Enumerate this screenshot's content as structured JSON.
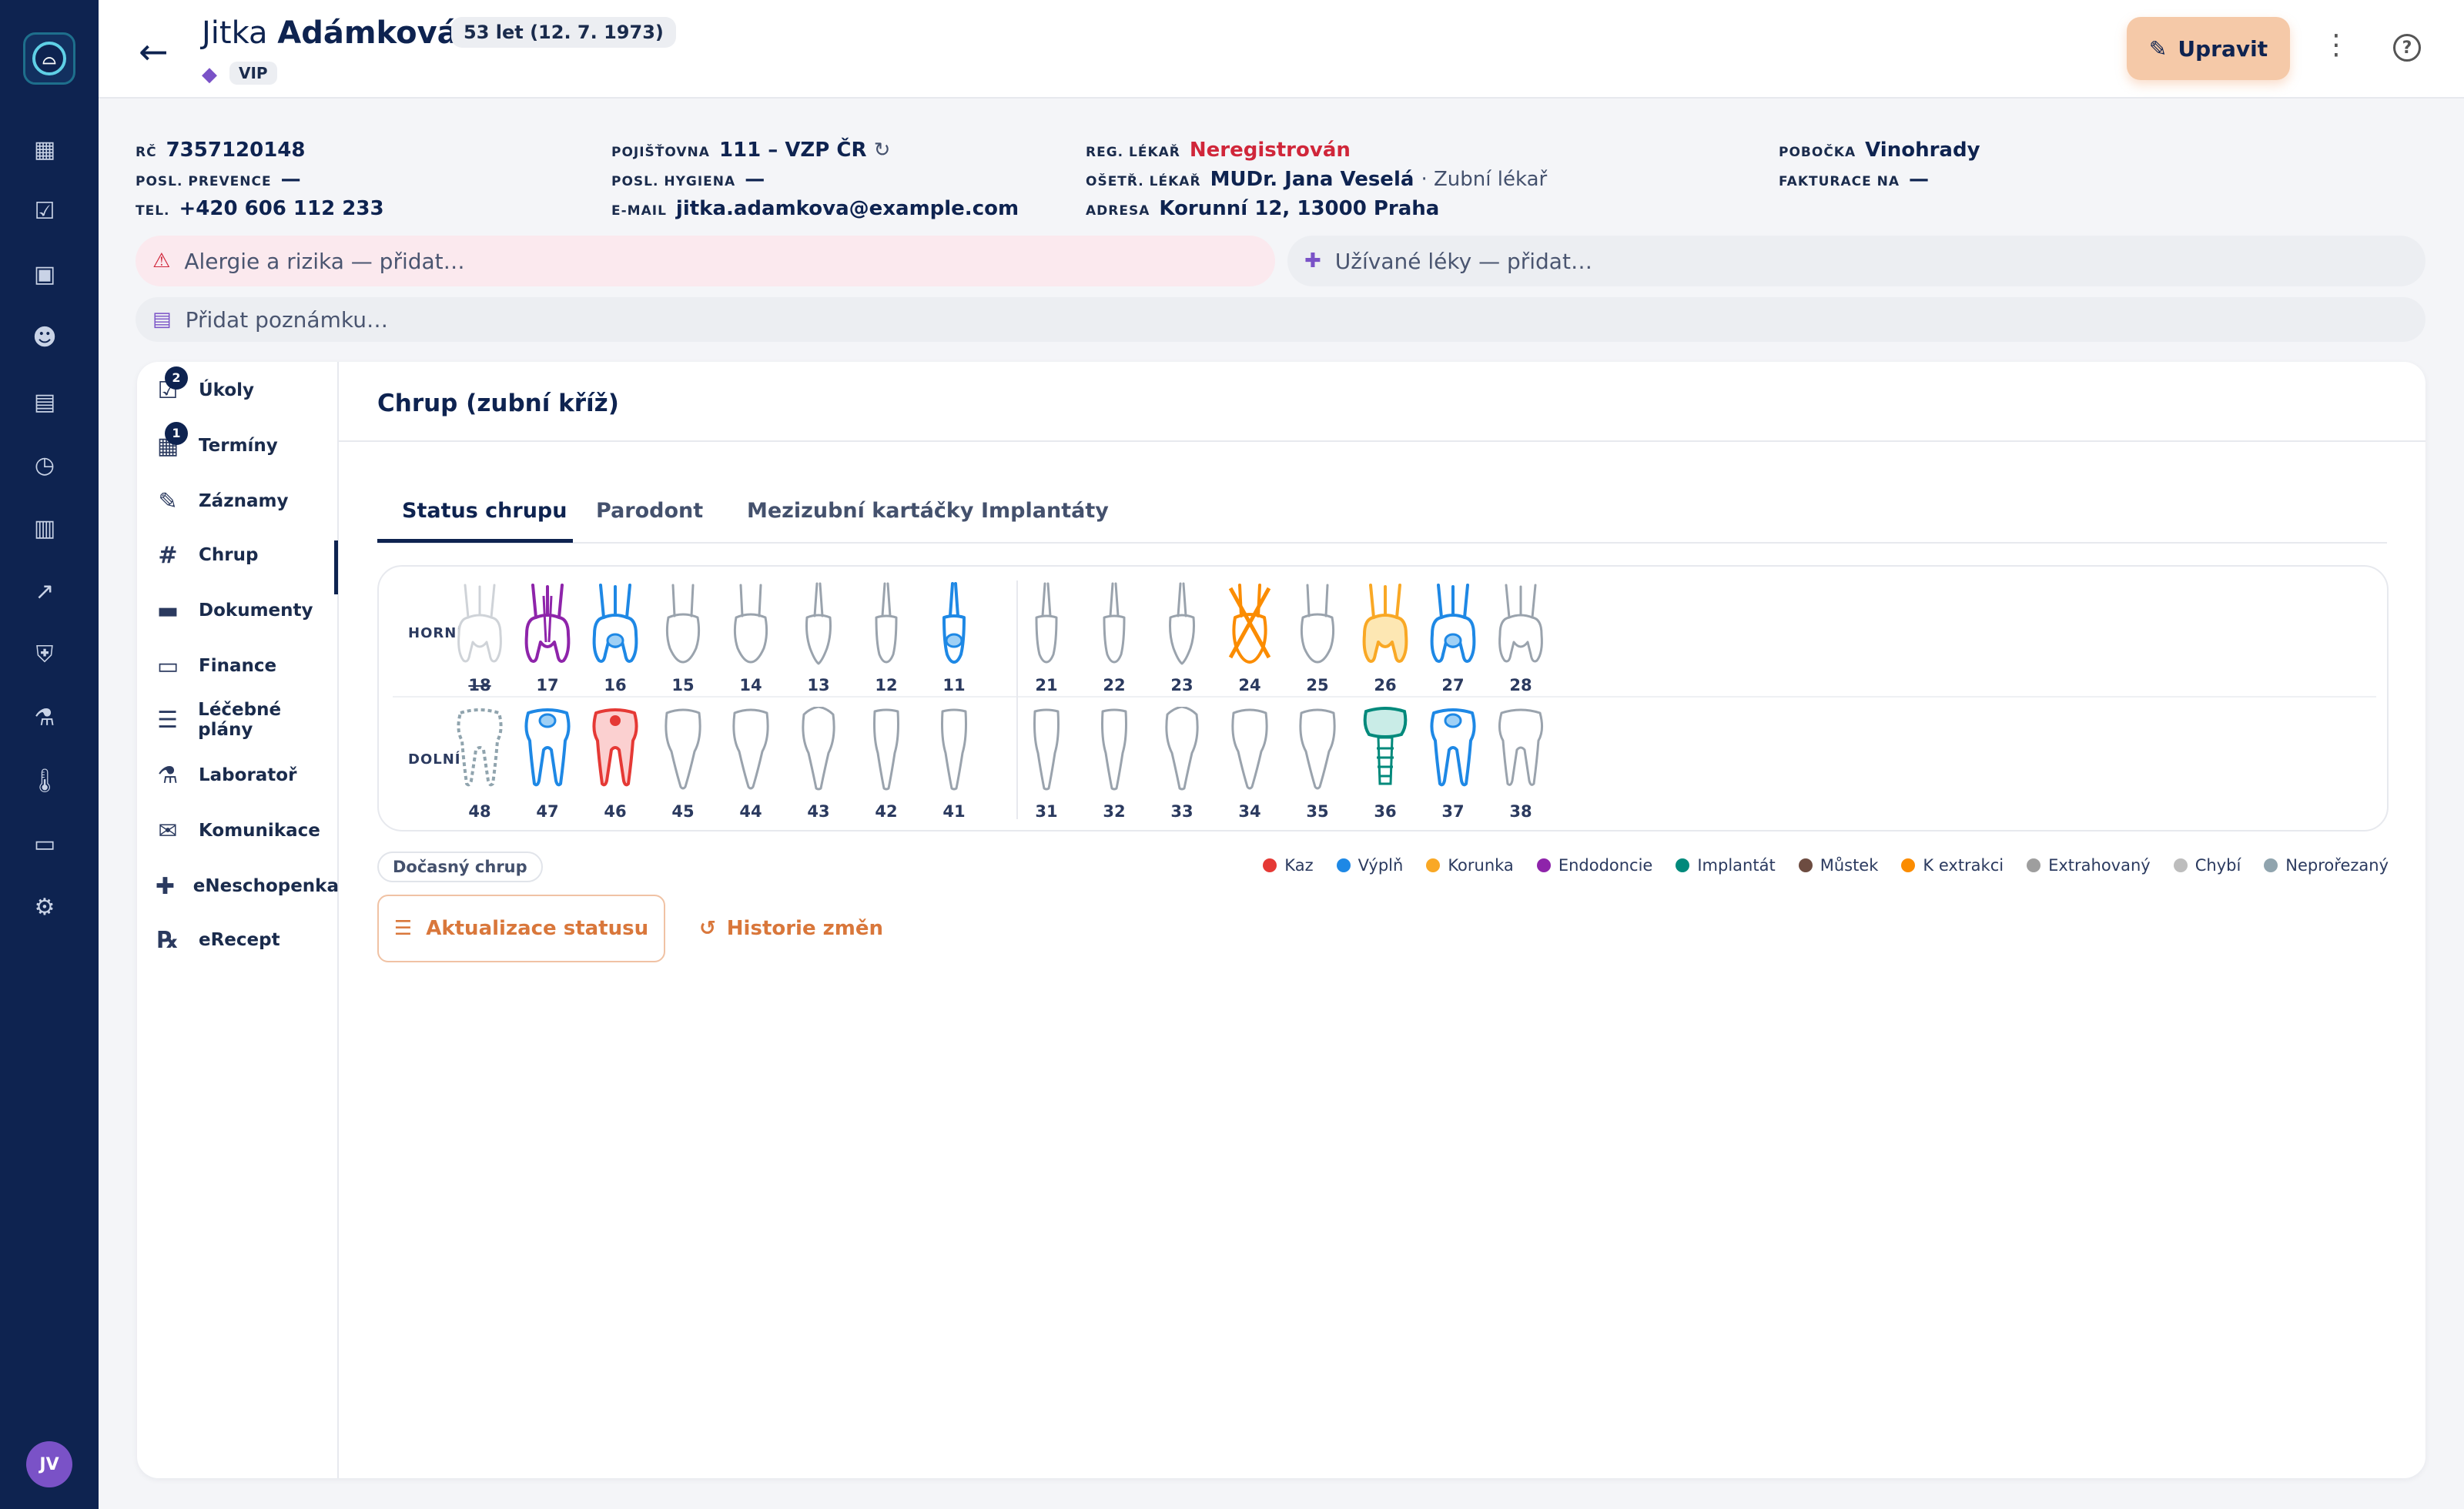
{
  "patient": {
    "first_name": "Jitka",
    "last_name": "Adámková",
    "age": "53 let (12. 7. 1973)",
    "tag": "VIP"
  },
  "header": {
    "edit_label": "Upravit"
  },
  "info": {
    "rc": {
      "label": "RČ",
      "value": "7357120148"
    },
    "prevence": {
      "label": "POSL. PREVENCE",
      "value": "—"
    },
    "tel": {
      "label": "TEL.",
      "value": "+420 606 112 233"
    },
    "pojistovna": {
      "label": "POJIŠŤOVNA",
      "value": "111 – VZP ČR"
    },
    "hygiena": {
      "label": "POSL. HYGIENA",
      "value": "—"
    },
    "email": {
      "label": "E-MAIL",
      "value": "jitka.adamkova@example.com"
    },
    "reg": {
      "label": "REG. LÉKAŘ",
      "value": "Neregistrován"
    },
    "osetr": {
      "label": "OŠETŘ. LÉKAŘ",
      "value": "MUDr. Jana Veselá",
      "role": "· Zubní lékař"
    },
    "adresa": {
      "label": "ADRESA",
      "value": "Korunní 12, 13000 Praha"
    },
    "pobocka": {
      "label": "POBOČKA",
      "value": "Vinohrady"
    },
    "fakturace": {
      "label": "FAKTURACE NA",
      "value": "—"
    }
  },
  "notes": {
    "allergy": "Alergie a rizika — přidat…",
    "meds": "Užívané léky — přidat…",
    "note": "Přidat poznámku…"
  },
  "subnav": [
    {
      "label": "Úkoly",
      "icon": "task-check-icon",
      "glyph": "☑",
      "badge": "2"
    },
    {
      "label": "Termíny",
      "icon": "calendar-check-icon",
      "glyph": "▦",
      "badge": "1"
    },
    {
      "label": "Záznamy",
      "icon": "clipboard-edit-icon",
      "glyph": "✎"
    },
    {
      "label": "Chrup",
      "icon": "grid-icon",
      "glyph": "#"
    },
    {
      "label": "Dokumenty",
      "icon": "folder-icon",
      "glyph": "▬"
    },
    {
      "label": "Finance",
      "icon": "money-icon",
      "glyph": "▭"
    },
    {
      "label": "Léčebné plány",
      "icon": "checklist-icon",
      "glyph": "☰"
    },
    {
      "label": "Laboratoř",
      "icon": "microscope-icon",
      "glyph": "⚗"
    },
    {
      "label": "Komunikace",
      "icon": "chat-icon",
      "glyph": "✉"
    },
    {
      "label": "eNeschopenka",
      "icon": "medical-bag-icon",
      "glyph": "✚"
    },
    {
      "label": "eRecept",
      "icon": "prescription-icon",
      "glyph": "℞"
    }
  ],
  "content": {
    "title": "Chrup (zubní kříž)",
    "tabs": [
      "Status chrupu",
      "Parodont",
      "Mezizubní kartáčky",
      "Implantáty"
    ],
    "row_upper": "HORNÍ",
    "row_lower": "DOLNÍ",
    "temp_chip": "Dočasný chrup",
    "update_button": "Aktualizace statusu",
    "history_button": "Historie změn"
  },
  "teeth": {
    "upper": [
      {
        "num": "18",
        "status": "missing",
        "type": "molar"
      },
      {
        "num": "17",
        "status": "endo",
        "type": "molar"
      },
      {
        "num": "16",
        "status": "filling",
        "type": "molar"
      },
      {
        "num": "15",
        "status": "none",
        "type": "premolar"
      },
      {
        "num": "14",
        "status": "none",
        "type": "premolar"
      },
      {
        "num": "13",
        "status": "none",
        "type": "canine"
      },
      {
        "num": "12",
        "status": "none",
        "type": "incisor"
      },
      {
        "num": "11",
        "status": "filling",
        "type": "incisor"
      },
      {
        "num": "21",
        "status": "none",
        "type": "incisor"
      },
      {
        "num": "22",
        "status": "none",
        "type": "incisor"
      },
      {
        "num": "23",
        "status": "none",
        "type": "canine"
      },
      {
        "num": "24",
        "status": "extraction",
        "type": "premolar"
      },
      {
        "num": "25",
        "status": "none",
        "type": "premolar"
      },
      {
        "num": "26",
        "status": "crown",
        "type": "molar"
      },
      {
        "num": "27",
        "status": "filling",
        "type": "molar"
      },
      {
        "num": "28",
        "status": "none",
        "type": "molar"
      }
    ],
    "lower": [
      {
        "num": "48",
        "status": "unerupted",
        "type": "molar"
      },
      {
        "num": "47",
        "status": "filling",
        "type": "molar"
      },
      {
        "num": "46",
        "status": "caries",
        "type": "molar"
      },
      {
        "num": "45",
        "status": "none",
        "type": "premolar"
      },
      {
        "num": "44",
        "status": "none",
        "type": "premolar"
      },
      {
        "num": "43",
        "status": "none",
        "type": "canine"
      },
      {
        "num": "42",
        "status": "none",
        "type": "incisor"
      },
      {
        "num": "41",
        "status": "none",
        "type": "incisor"
      },
      {
        "num": "31",
        "status": "none",
        "type": "incisor"
      },
      {
        "num": "32",
        "status": "none",
        "type": "incisor"
      },
      {
        "num": "33",
        "status": "none",
        "type": "canine"
      },
      {
        "num": "34",
        "status": "none",
        "type": "premolar"
      },
      {
        "num": "35",
        "status": "none",
        "type": "premolar"
      },
      {
        "num": "36",
        "status": "implant",
        "type": "molar"
      },
      {
        "num": "37",
        "status": "filling",
        "type": "molar"
      },
      {
        "num": "38",
        "status": "none",
        "type": "molar"
      }
    ]
  },
  "legend": [
    {
      "label": "Kaz",
      "color": "#e53935"
    },
    {
      "label": "Výplň",
      "color": "#1e88e5"
    },
    {
      "label": "Korunka",
      "color": "#f9a825"
    },
    {
      "label": "Endodoncie",
      "color": "#8e24aa"
    },
    {
      "label": "Implantát",
      "color": "#00897b"
    },
    {
      "label": "Můstek",
      "color": "#6d4c41"
    },
    {
      "label": "K extrakci",
      "color": "#fb8c00"
    },
    {
      "label": "Extrahovaný",
      "color": "#9e9e9e"
    },
    {
      "label": "Chybí",
      "color": "#bdbdbd"
    },
    {
      "label": "Neprořezaný",
      "color": "#90a4ae"
    }
  ]
}
